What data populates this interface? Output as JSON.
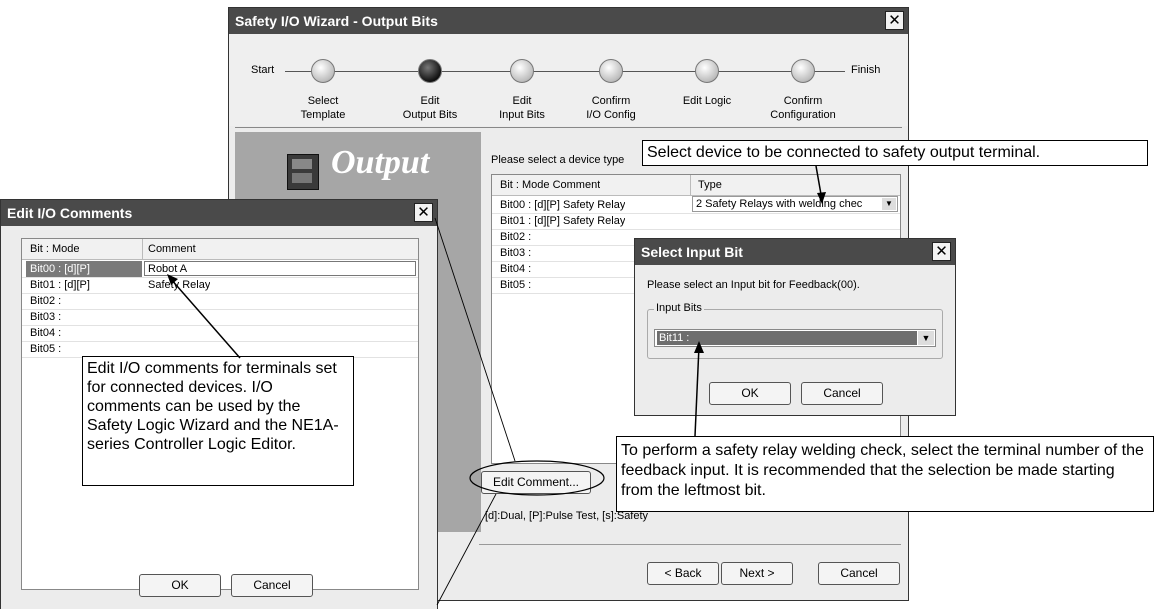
{
  "wizard": {
    "title": "Safety I/O Wizard - Output Bits",
    "steps": {
      "start": "Start",
      "finish": "Finish",
      "items": [
        {
          "label_line1": "Select",
          "label_line2": "Template"
        },
        {
          "label_line1": "Edit",
          "label_line2": "Output Bits"
        },
        {
          "label_line1": "Edit",
          "label_line2": "Input Bits"
        },
        {
          "label_line1": "Confirm",
          "label_line2": "I/O Config"
        },
        {
          "label_line1": "Edit Logic",
          "label_line2": ""
        },
        {
          "label_line1": "Confirm",
          "label_line2": "Configuration"
        }
      ]
    },
    "banner_text": "Output",
    "prompt": "Please select a device type",
    "table": {
      "headers": [
        "Bit : Mode Comment",
        "Type"
      ],
      "rows": [
        {
          "bit": "Bit00 : [d][P] Safety Relay",
          "type": "2 Safety Relays with welding chec"
        },
        {
          "bit": "Bit01 : [d][P] Safety Relay",
          "type": ""
        },
        {
          "bit": "Bit02 :",
          "type": ""
        },
        {
          "bit": "Bit03 :",
          "type": ""
        },
        {
          "bit": "Bit04 :",
          "type": ""
        },
        {
          "bit": "Bit05 :",
          "type": ""
        }
      ]
    },
    "edit_comment_button": "Edit Comment...",
    "legend": "[d]:Dual, [P]:Pulse Test, [s]:Safety",
    "back_button": "< Back",
    "next_button": "Next >",
    "cancel_button": "Cancel"
  },
  "edit_comments_dialog": {
    "title": "Edit I/O Comments",
    "headers": [
      "Bit : Mode",
      "Comment"
    ],
    "rows": [
      {
        "bit": "Bit00 : [d][P]",
        "comment": "Robot A"
      },
      {
        "bit": "Bit01 : [d][P]",
        "comment": "Safety Relay"
      },
      {
        "bit": "Bit02 :",
        "comment": ""
      },
      {
        "bit": "Bit03 :",
        "comment": ""
      },
      {
        "bit": "Bit04 :",
        "comment": ""
      },
      {
        "bit": "Bit05 :",
        "comment": ""
      }
    ],
    "ok_button": "OK",
    "cancel_button": "Cancel"
  },
  "select_input_dialog": {
    "title": "Select Input Bit",
    "prompt": "Please select an Input bit for Feedback(00).",
    "group_label": "Input Bits",
    "selected_value": "Bit11 :",
    "ok_button": "OK",
    "cancel_button": "Cancel"
  },
  "callouts": {
    "device": "Select device to be connected to safety output terminal.",
    "comments": "Edit I/O comments for terminals set for connected devices. I/O comments can be used by the Safety Logic Wizard and the NE1A-series Controller Logic Editor.",
    "feedback": "To perform a safety relay welding check, select the terminal number of the feedback input. It is recommended that the selection be made starting from the leftmost bit."
  },
  "icons": [
    "close-icon",
    "dropdown-arrow-icon",
    "controller-device-icon"
  ]
}
